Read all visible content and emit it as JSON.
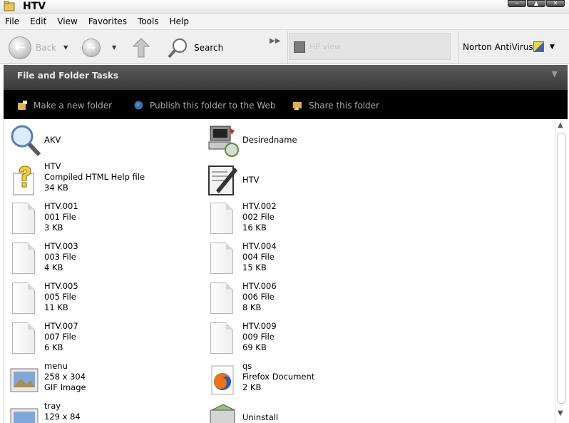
{
  "window": {
    "title": "HTV",
    "buttons": [
      "–",
      "▲",
      "✕"
    ]
  },
  "menu": [
    "File",
    "Edit",
    "View",
    "Favorites",
    "Tools",
    "Help"
  ],
  "toolbar": {
    "back_label": "Back",
    "search_label": "Search",
    "address_text": "HP view",
    "norton_label": "Norton AntiVirus"
  },
  "tasks": {
    "header": "File and Folder Tasks",
    "items": [
      "Make a new folder",
      "Publish this folder to the Web",
      "Share this folder"
    ]
  },
  "files": [
    {
      "name": "AKV",
      "type": "",
      "size": "",
      "icon": "search-icon"
    },
    {
      "name": "Desiredname",
      "type": "",
      "size": "",
      "icon": "computer-icon"
    },
    {
      "name": "HTV",
      "type": "Compiled HTML Help file",
      "size": "34 KB",
      "icon": "help-file-icon"
    },
    {
      "name": "HTV",
      "type": "",
      "size": "",
      "icon": "text-edit-icon"
    },
    {
      "name": "HTV.001",
      "type": "001 File",
      "size": "3 KB",
      "icon": "document-icon"
    },
    {
      "name": "HTV.002",
      "type": "002 File",
      "size": "16 KB",
      "icon": "document-icon"
    },
    {
      "name": "HTV.003",
      "type": "003 File",
      "size": "4 KB",
      "icon": "document-icon"
    },
    {
      "name": "HTV.004",
      "type": "004 File",
      "size": "15 KB",
      "icon": "document-icon"
    },
    {
      "name": "HTV.005",
      "type": "005 File",
      "size": "11 KB",
      "icon": "document-icon"
    },
    {
      "name": "HTV.006",
      "type": "006 File",
      "size": "8 KB",
      "icon": "document-icon"
    },
    {
      "name": "HTV.007",
      "type": "007 File",
      "size": "6 KB",
      "icon": "document-icon"
    },
    {
      "name": "HTV.009",
      "type": "009 File",
      "size": "69 KB",
      "icon": "document-icon"
    },
    {
      "name": "menu",
      "type": "258 x 304",
      "size": "GIF Image",
      "icon": "image-icon"
    },
    {
      "name": "qs",
      "type": "Firefox Document",
      "size": "2 KB",
      "icon": "firefox-icon"
    },
    {
      "name": "tray",
      "type": "129 x 84",
      "size": "",
      "icon": "image-icon"
    },
    {
      "name": "Uninstall",
      "type": "",
      "size": "",
      "icon": "uninstall-icon"
    }
  ],
  "colors": {
    "task_header": "#4a4a4a",
    "task_body": "#000000",
    "task_text": "#a8a8a8"
  }
}
